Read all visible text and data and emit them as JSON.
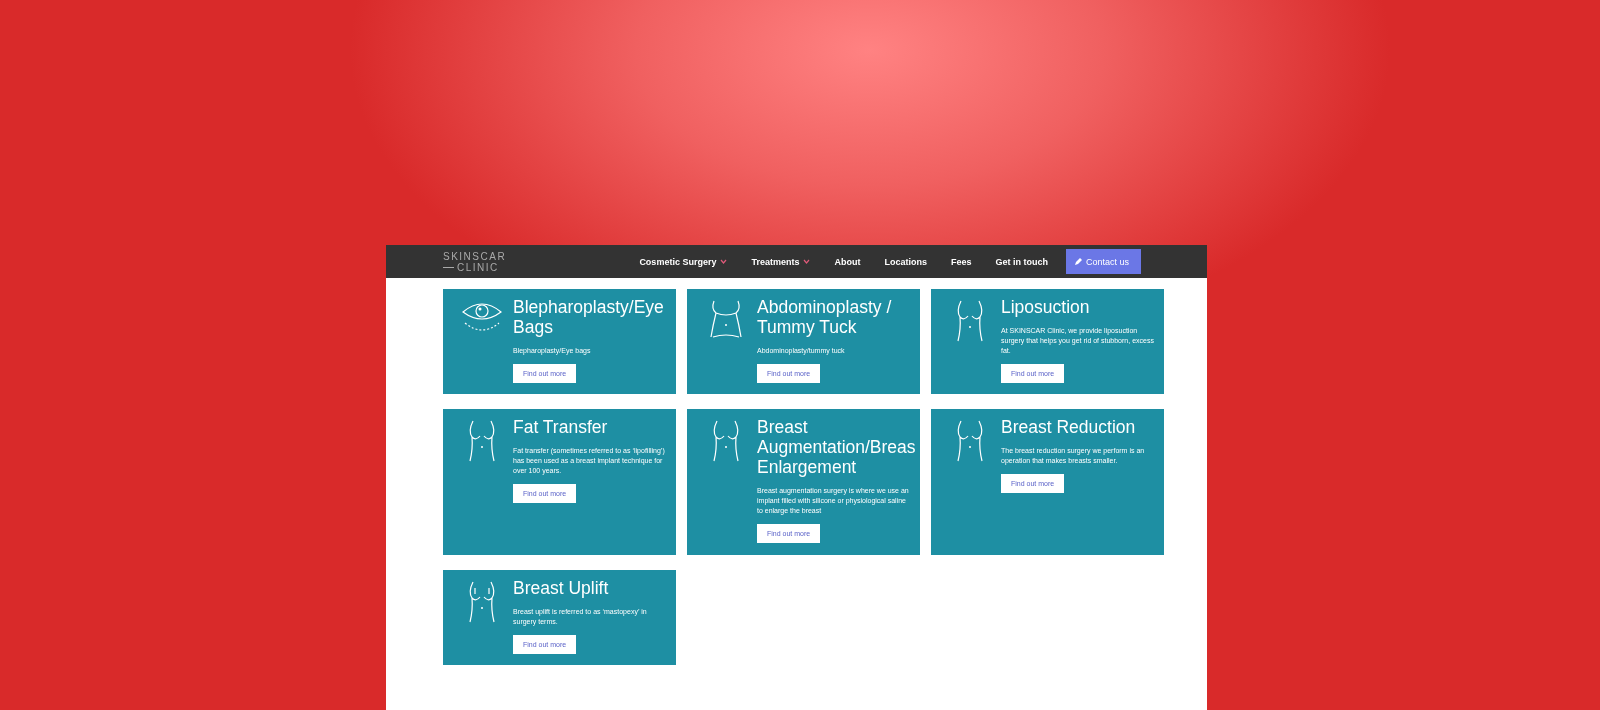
{
  "header": {
    "logo": {
      "line_1": "SKINSCAR",
      "line_2": "CLINIC"
    },
    "nav": [
      {
        "label": "Cosmetic Surgery",
        "has_dropdown": true
      },
      {
        "label": "Treatments",
        "has_dropdown": true
      },
      {
        "label": "About",
        "has_dropdown": false
      },
      {
        "label": "Locations",
        "has_dropdown": false
      },
      {
        "label": "Fees",
        "has_dropdown": false
      },
      {
        "label": "Get in touch",
        "has_dropdown": false
      }
    ],
    "contact_button": "Contact us"
  },
  "cards": [
    {
      "kind": "eye",
      "title": "Blepharoplasty/Eye Bags",
      "text": "Blepharoplasty/Eye bags",
      "button": "Find out more"
    },
    {
      "kind": "torso",
      "title": "Abdominoplasty / Tummy Tuck",
      "text": "Abdominoplasty/tummy tuck",
      "button": "Find out more"
    },
    {
      "kind": "body",
      "title": "Liposuction",
      "text": "At SKINSCAR Clinic, we provide liposuction surgery that helps you get rid of stubborn, excess fat.",
      "button": "Find out more"
    },
    {
      "kind": "body",
      "title": "Fat Transfer",
      "text": "Fat transfer (sometimes referred to as ‘lipofilling’) has been used as a breast implant technique for over 100 years.",
      "button": "Find out more"
    },
    {
      "kind": "body",
      "title": "Breast Augmentation/Breas Enlargement",
      "text": "Breast augmentation surgery is where we use an implant filled with silicone or physiological saline to enlarge the breast",
      "button": "Find out more"
    },
    {
      "kind": "body",
      "title": "Breast Reduction",
      "text": "The breast reduction surgery we perform is an operation that makes breasts smaller.",
      "button": "Find out more"
    },
    {
      "kind": "uplift",
      "title": "Breast Uplift",
      "text": "Breast uplift is referred to as ‘mastopexy’ in surgery terms.",
      "button": "Find out more"
    }
  ]
}
